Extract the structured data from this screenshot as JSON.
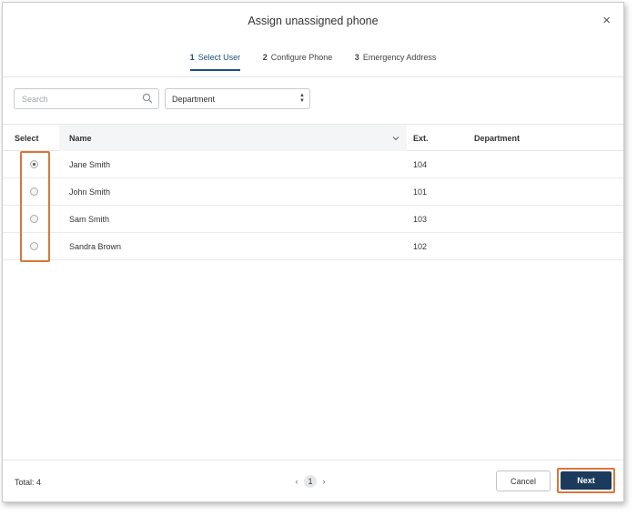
{
  "dialog": {
    "title": "Assign unassigned phone",
    "close_glyph": "×"
  },
  "steps": [
    {
      "num": "1",
      "label": "Select User",
      "active": true
    },
    {
      "num": "2",
      "label": "Configure Phone",
      "active": false
    },
    {
      "num": "3",
      "label": "Emergency Address",
      "active": false
    }
  ],
  "filters": {
    "search_placeholder": "Search",
    "search_value": "",
    "department_selected": "Department"
  },
  "table": {
    "headers": {
      "select": "Select",
      "name": "Name",
      "ext": "Ext.",
      "department": "Department"
    },
    "rows": [
      {
        "name": "Jane Smith",
        "ext": "104",
        "department": "",
        "selected": true
      },
      {
        "name": "John Smith",
        "ext": "101",
        "department": "",
        "selected": false
      },
      {
        "name": "Sam Smith",
        "ext": "103",
        "department": "",
        "selected": false
      },
      {
        "name": "Sandra Brown",
        "ext": "102",
        "department": "",
        "selected": false
      }
    ]
  },
  "footer": {
    "total": "Total: 4",
    "page": "1",
    "prev_glyph": "‹",
    "next_glyph": "›",
    "cancel_label": "Cancel",
    "next_label": "Next"
  },
  "colors": {
    "accent": "#1d4f7c",
    "primary_button": "#1b3a5c",
    "highlight": "#d9773a"
  },
  "icons": {
    "search": "search-icon",
    "close": "close-icon",
    "sort": "chevron-down-icon",
    "select_arrows": "select-arrows-icon"
  }
}
